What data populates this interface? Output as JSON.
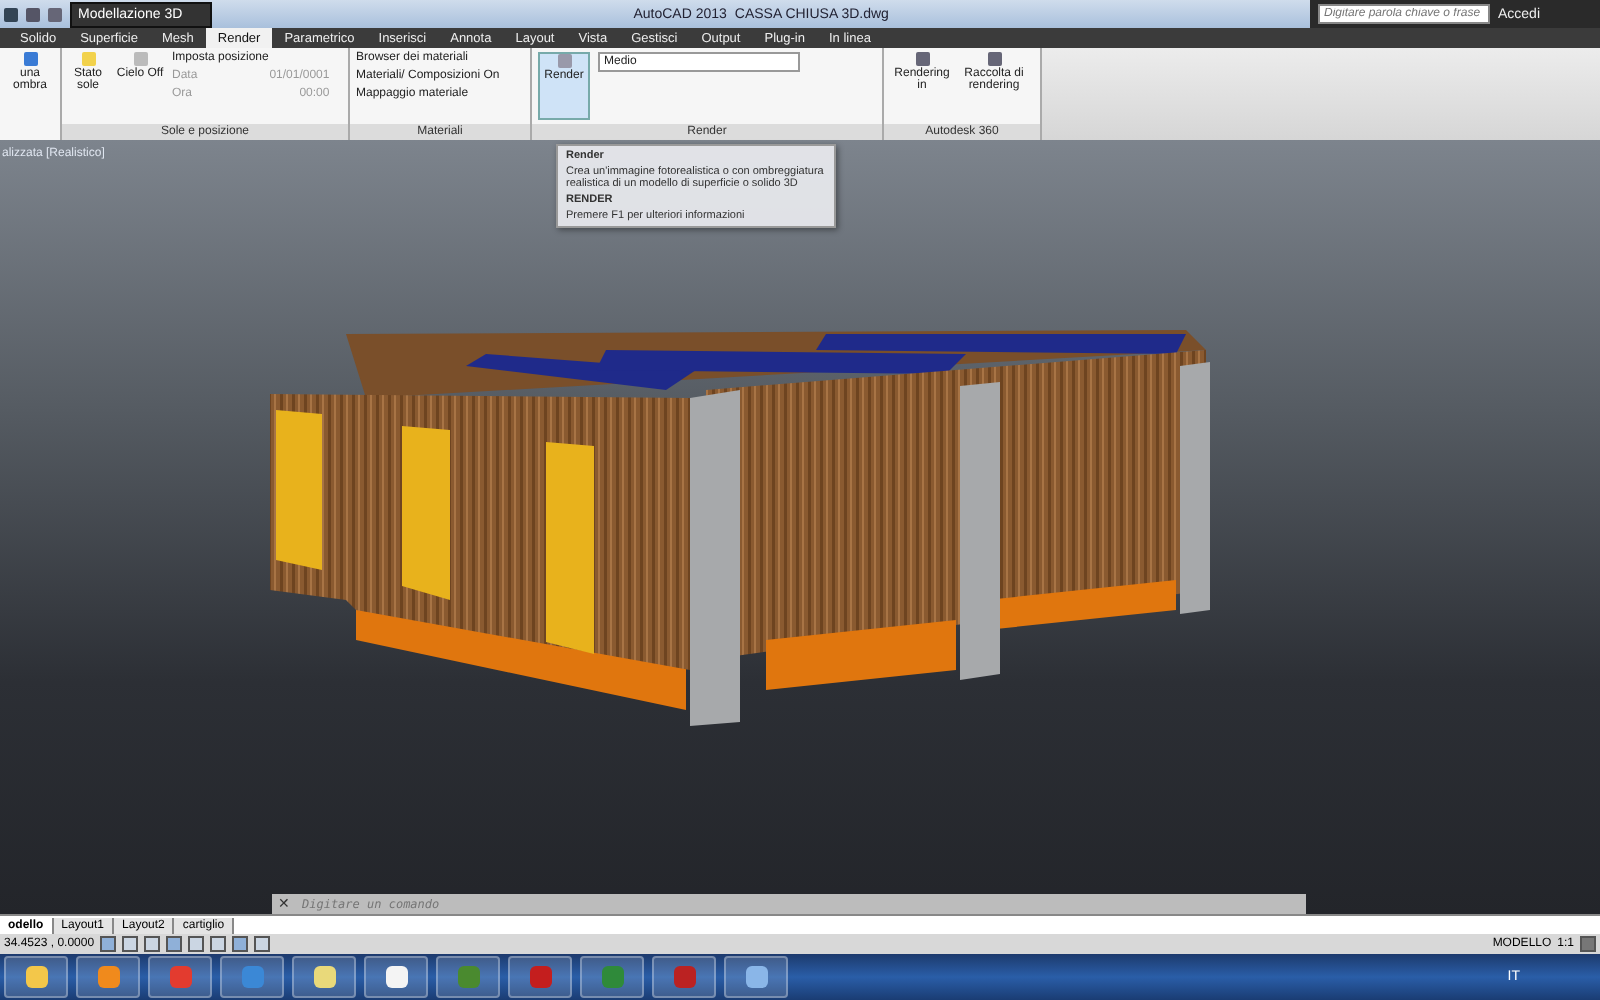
{
  "title_bar": {
    "workspace": "Modellazione 3D",
    "app": "AutoCAD 2013",
    "file": "CASSA CHIUSA 3D.dwg",
    "search": {
      "placeholder": "Digitare parola chiave o frase"
    },
    "sign_in": "Accedi"
  },
  "tabs": [
    {
      "label": "Solido",
      "selected": false
    },
    {
      "label": "Superficie",
      "selected": false
    },
    {
      "label": "Mesh",
      "selected": false
    },
    {
      "label": "Render",
      "selected": true
    },
    {
      "label": "Parametrico",
      "selected": false
    },
    {
      "label": "Inserisci",
      "selected": false
    },
    {
      "label": "Annota",
      "selected": false
    },
    {
      "label": "Layout",
      "selected": false
    },
    {
      "label": "Vista",
      "selected": false
    },
    {
      "label": "Gestisci",
      "selected": false
    },
    {
      "label": "Output",
      "selected": false
    },
    {
      "label": "Plug-in",
      "selected": false
    },
    {
      "label": "In linea",
      "selected": false
    }
  ],
  "ribbon": {
    "shadow_button": "una ombra",
    "sun": {
      "label": "Sole e posizione",
      "sun_status": "Stato sole",
      "sky": "Cielo Off",
      "location": "Imposta posizione",
      "date_label": "Data",
      "date": "01/01/0001",
      "time_label": "Ora",
      "time": "00:00"
    },
    "materials": {
      "label": "Materiali",
      "items": [
        "Browser dei materiali",
        "Materiali/ Composizioni On",
        "Mappaggio materiale"
      ]
    },
    "render": {
      "label": "Render",
      "button": "Render",
      "quality": "Medio"
    },
    "cloud": {
      "label": "Autodesk 360",
      "items": [
        "Rendering in",
        "Raccolta di rendering"
      ]
    }
  },
  "tooltip": {
    "title": "Render",
    "description": "Crea un'immagine fotorealistica o con ombreggiatura realistica di un modello di superficie o solido 3D",
    "command": "RENDER",
    "help": "Premere F1 per ulteriori informazioni"
  },
  "viewport": {
    "label": "alizzata [Realistico]"
  },
  "command_line": {
    "close": "✕",
    "placeholder": "Digitare un comando"
  },
  "layout_tabs": [
    {
      "label": "odello",
      "selected": true
    },
    {
      "label": "Layout1",
      "selected": false
    },
    {
      "label": "Layout2",
      "selected": false
    },
    {
      "label": "cartiglio",
      "selected": false
    }
  ],
  "status_bar": {
    "coordinates": "34.4523 , 0.0000",
    "space": "MODELLO",
    "scale": "1:1"
  },
  "taskbar": {
    "language": "IT"
  }
}
